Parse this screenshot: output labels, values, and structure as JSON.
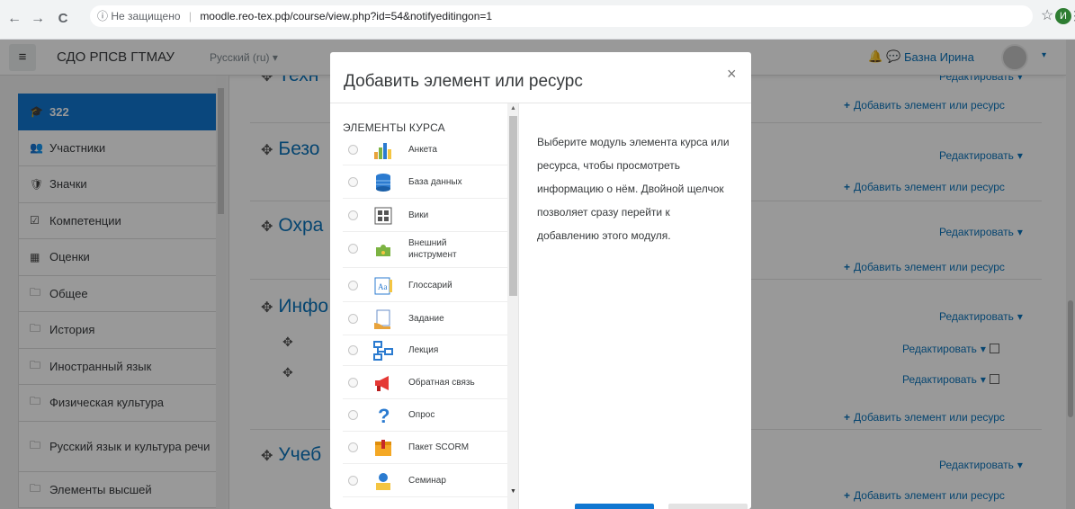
{
  "browser": {
    "back": "←",
    "forward": "→",
    "reload": "C",
    "info_icon": "ⓘ",
    "security_text": "Не защищено",
    "url": "moodle.reo-tex.рф/course/view.php?id=54&notifyeditingon=1",
    "profile_initial": "И"
  },
  "navbar": {
    "site_name": "СДО РПСВ ГТМАУ",
    "language": "Русский (ru) ▾",
    "user_name": "Базна Ирина",
    "user_caret": "▾"
  },
  "drawer": {
    "items": [
      {
        "icon": "graduation-cap-icon",
        "glyph": "🎓",
        "label": "322"
      },
      {
        "icon": "users-icon",
        "glyph": "👥",
        "label": "Участники"
      },
      {
        "icon": "shield-icon",
        "glyph": "🛡",
        "label": "Значки"
      },
      {
        "icon": "check-square-icon",
        "glyph": "☑",
        "label": "Компетенции"
      },
      {
        "icon": "table-icon",
        "glyph": "▦",
        "label": "Оценки"
      },
      {
        "icon": "folder-icon",
        "glyph": "🗀",
        "label": "Общее"
      },
      {
        "icon": "folder-icon",
        "glyph": "🗀",
        "label": "История"
      },
      {
        "icon": "folder-icon",
        "glyph": "🗀",
        "label": "Иностранный язык"
      },
      {
        "icon": "folder-icon",
        "glyph": "🗀",
        "label": "Физическая культура"
      },
      {
        "icon": "folder-icon",
        "glyph": "🗀",
        "label": "Русский язык и культура речи"
      },
      {
        "icon": "folder-icon",
        "glyph": "🗀",
        "label": "Элементы высшей"
      }
    ]
  },
  "main": {
    "move_glyph": "✥",
    "section_titles": [
      "Техн",
      "Безо",
      "Охра",
      "Инфо",
      "Учеб"
    ],
    "edit_label": "Редактировать",
    "edit_caret": "▾",
    "add_label": "Добавить элемент или ресурс",
    "add_plus": "+"
  },
  "modal": {
    "title": "Добавить элемент или ресурс",
    "close": "×",
    "options_heading": "ЭЛЕМЕНТЫ КУРСА",
    "options": [
      {
        "label": "Анкета",
        "icon": "survey-chart-icon"
      },
      {
        "label": "База данных",
        "icon": "database-icon"
      },
      {
        "label": "Вики",
        "icon": "wiki-icon"
      },
      {
        "label": "Внешний инструмент",
        "icon": "puzzle-piece-icon"
      },
      {
        "label": "Глоссарий",
        "icon": "glossary-icon"
      },
      {
        "label": "Задание",
        "icon": "assignment-hand-icon"
      },
      {
        "label": "Лекция",
        "icon": "lesson-icon"
      },
      {
        "label": "Обратная связь",
        "icon": "megaphone-icon"
      },
      {
        "label": "Опрос",
        "icon": "question-mark-icon"
      },
      {
        "label": "Пакет SCORM",
        "icon": "scorm-package-icon"
      },
      {
        "label": "Семинар",
        "icon": "workshop-icon"
      }
    ],
    "description": "Выберите модуль элемента курса или ресурса, чтобы просмотреть информацию о нём. Двойной щелчок позволяет сразу перейти к добавлению этого модуля."
  },
  "colors": {
    "accent": "#1177d1",
    "link": "#0a73bb"
  }
}
